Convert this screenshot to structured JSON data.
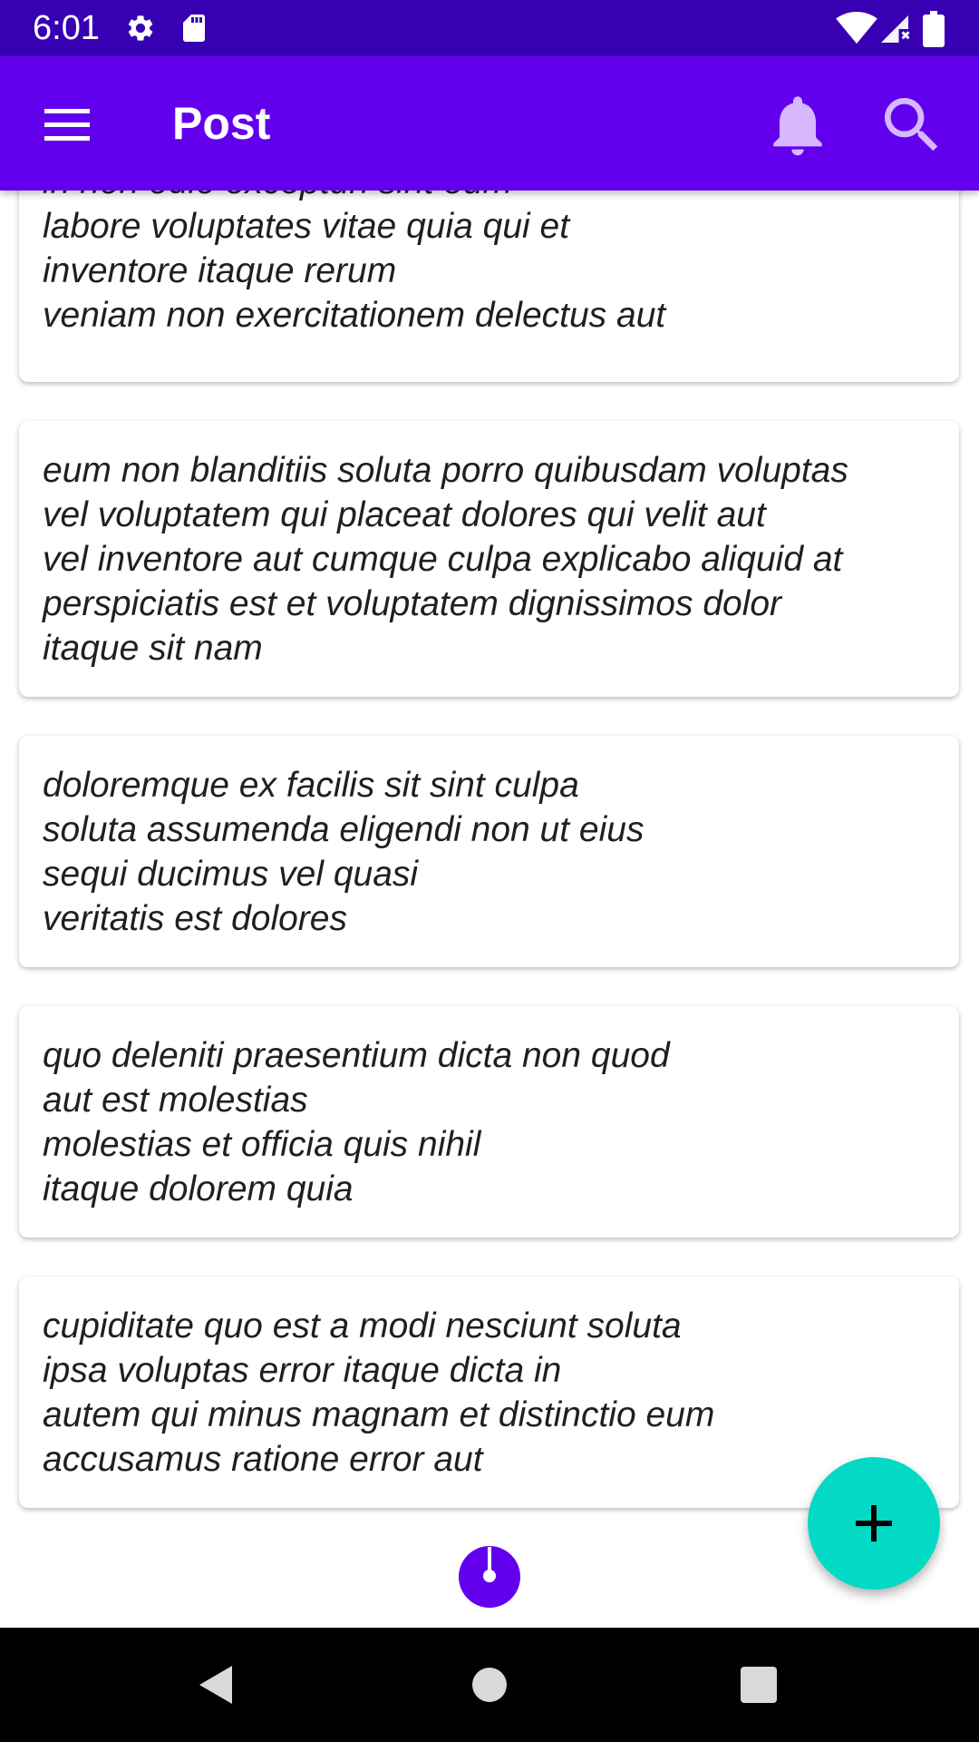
{
  "status_bar": {
    "time": "6:01",
    "icons": [
      "gear-icon",
      "sd-card-icon",
      "wifi-icon",
      "signal-icon",
      "battery-icon"
    ]
  },
  "app_bar": {
    "title": "Post",
    "icons": [
      "menu-icon",
      "bell-icon",
      "search-icon"
    ]
  },
  "posts": [
    {
      "body": "in non odio excepturi sint eum\nlabore voluptates vitae quia qui et\ninventore itaque rerum\nveniam non exercitationem delectus aut"
    },
    {
      "body": "eum non blanditiis soluta porro quibusdam voluptas\nvel voluptatem qui placeat dolores qui velit aut\nvel inventore aut cumque culpa explicabo aliquid at\nperspiciatis est et voluptatem dignissimos dolor\nitaque sit nam"
    },
    {
      "body": "doloremque ex facilis sit sint culpa\nsoluta assumenda eligendi non ut eius\nsequi ducimus vel quasi\nveritatis est dolores"
    },
    {
      "body": "quo deleniti praesentium dicta non quod\naut est molestias\nmolestias et officia quis nihil\nitaque dolorem quia"
    },
    {
      "body": "cupiditate quo est a modi nesciunt soluta\nipsa voluptas error itaque dicta in\nautem qui minus magnam et distinctio eum\naccusamus ratione error aut"
    }
  ],
  "fab": {
    "icon": "plus-icon"
  },
  "loading": {
    "icon": "progress-spinner-icon"
  },
  "nav_bar": {
    "icons": [
      "back-icon",
      "home-icon",
      "recents-icon"
    ]
  },
  "colors": {
    "status_bar": "#3700b3",
    "primary": "#6200ee",
    "accent": "#03dac5",
    "bell_tint": "#d7b8ff",
    "nav_bar": "#000000"
  }
}
